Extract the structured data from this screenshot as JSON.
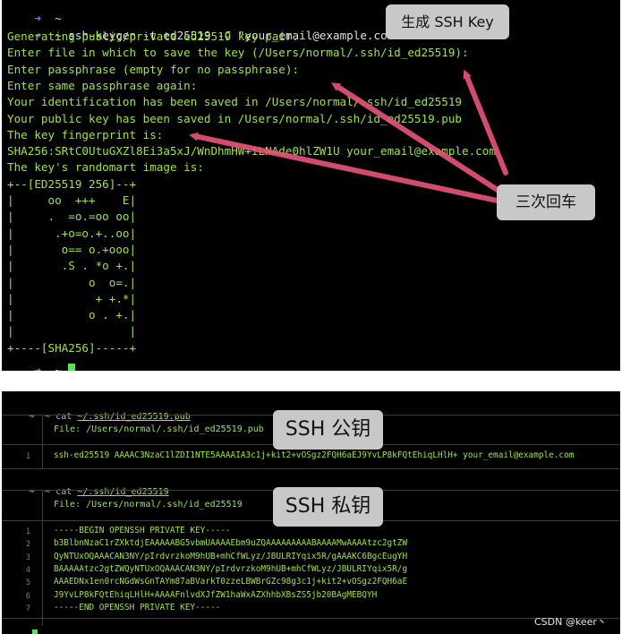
{
  "terminal1": {
    "prompt_arrow": "➜",
    "prompt_tilde": "~",
    "command": "ssh-keygen -t ed25519 -C \"your_email@example.com\"",
    "output": [
      "Generating public/private ed25519 key pair.",
      "Enter file in which to save the key (/Users/normal/.ssh/id_ed25519):",
      "Enter passphrase (empty for no passphrase):",
      "Enter same passphrase again:",
      "Your identification has been saved in /Users/normal/.ssh/id_ed25519",
      "Your public key has been saved in /Users/normal/.ssh/id_ed25519.pub",
      "The key fingerprint is:",
      "SHA256:SRtC0UtuGXZl8Ei3a5xJ/WnDhmHW+iLNAde0hlZW1U your_email@example.com",
      "The key's randomart image is:",
      "+--[ED25519 256]--+",
      "|     oo  +++    E|",
      "|     .  =o.=oo oo|",
      "|      .+o=o.+..oo|",
      "|       o== o.+ooo|",
      "|       .S . *o +.|",
      "|           o  o=.|",
      "|            + +.*|",
      "|           o . +.|",
      "|                 |",
      "+----[SHA256]-----+"
    ]
  },
  "terminal2": {
    "first_line": "➜  ~",
    "pub_cmd": {
      "arrow": "➜",
      "tilde": "~",
      "cat": "cat",
      "path": "~/.ssh/id_ed25519.pub"
    },
    "pub_file_label": "File: /Users/normal/.ssh/id_ed25519.pub",
    "pub_lines": [
      {
        "num": "1",
        "text": "ssh-ed25519 AAAAC3NzaC1lZDI1NTE5AAAAIA3c1j+kit2+vOSgz2FQH6aEJ9YvLP8kFQtEhiqLHlH+ your_email@example.com"
      }
    ],
    "priv_cmd": {
      "arrow": "➜",
      "tilde": "~",
      "cat": "cat",
      "path": "~/.ssh/id_ed25519"
    },
    "priv_file_label": "File: /Users/normal/.ssh/id_ed25519",
    "priv_lines": [
      {
        "num": "1",
        "text": "-----BEGIN OPENSSH PRIVATE KEY-----"
      },
      {
        "num": "2",
        "text": "b3BlbnNzaC1rZXktdjEAAAAABG5vbmUAAAAEbm9uZQAAAAAAAAABAAAAMwAAAAtzc2gtZW"
      },
      {
        "num": "3",
        "text": "QyNTUxOQAAACAN3NY/pIrdvrzkoM9hUB+mhCfWLyz/JBULRIYqix5R/gAAAKC6BgcEugYH"
      },
      {
        "num": "4",
        "text": "BAAAAAtzc2gtZWQyNTUxOQAAACAN3NY/pIrdvrzkoM9hUB+mhCfWLyz/JBULRIYqix5R/g"
      },
      {
        "num": "5",
        "text": "AAAEDNx1en0rcNGdWsGnTAYm87aBVarkT0zzeLBWBrGZc98g3c1j+kit2+vOSgz2FQH6aE"
      },
      {
        "num": "6",
        "text": "J9YvLP8kFQtEhiqLHlH+AAAAFnlvdXJfZW1haWxAZXhhbXBsZS5jb20BAgMEBQYH"
      },
      {
        "num": "7",
        "text": "-----END OPENSSH PRIVATE KEY-----"
      }
    ]
  },
  "callouts": {
    "generate": "生成 SSH Key",
    "enter_three_times": "三次回车",
    "public_key": "SSH 公钥",
    "private_key": "SSH 私钥"
  },
  "watermark": "CSDN @keer丶",
  "colors": {
    "terminal_bg": "#000000",
    "text_green": "#9ee34f",
    "prompt_blue": "#5b8de6",
    "arrow_pink": "#e8557a",
    "callout_bg": "#c8c8c8"
  }
}
